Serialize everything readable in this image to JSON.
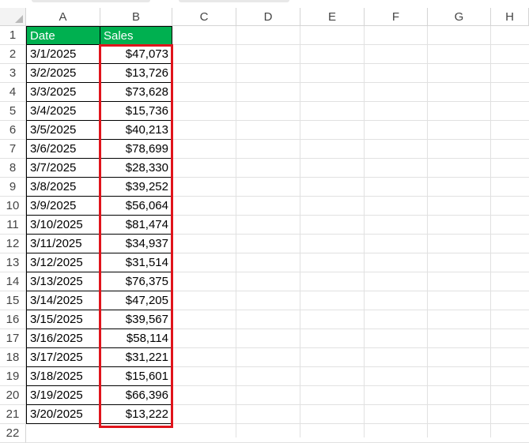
{
  "columns": [
    "A",
    "B",
    "C",
    "D",
    "E",
    "F",
    "G",
    "H"
  ],
  "rows": [
    "1",
    "2",
    "3",
    "4",
    "5",
    "6",
    "7",
    "8",
    "9",
    "10",
    "11",
    "12",
    "13",
    "14",
    "15",
    "16",
    "17",
    "18",
    "19",
    "20",
    "21",
    "22"
  ],
  "header": {
    "date": "Date",
    "sales": "Sales"
  },
  "data": [
    {
      "date": "3/1/2025",
      "sales": "$47,073"
    },
    {
      "date": "3/2/2025",
      "sales": "$13,726"
    },
    {
      "date": "3/3/2025",
      "sales": "$73,628"
    },
    {
      "date": "3/4/2025",
      "sales": "$15,736"
    },
    {
      "date": "3/5/2025",
      "sales": "$40,213"
    },
    {
      "date": "3/6/2025",
      "sales": "$78,699"
    },
    {
      "date": "3/7/2025",
      "sales": "$28,330"
    },
    {
      "date": "3/8/2025",
      "sales": "$39,252"
    },
    {
      "date": "3/9/2025",
      "sales": "$56,064"
    },
    {
      "date": "3/10/2025",
      "sales": "$81,474"
    },
    {
      "date": "3/11/2025",
      "sales": "$34,937"
    },
    {
      "date": "3/12/2025",
      "sales": "$31,514"
    },
    {
      "date": "3/13/2025",
      "sales": "$76,375"
    },
    {
      "date": "3/14/2025",
      "sales": "$47,205"
    },
    {
      "date": "3/15/2025",
      "sales": "$39,567"
    },
    {
      "date": "3/16/2025",
      "sales": "$58,114"
    },
    {
      "date": "3/17/2025",
      "sales": "$31,221"
    },
    {
      "date": "3/18/2025",
      "sales": "$15,601"
    },
    {
      "date": "3/19/2025",
      "sales": "$66,396"
    },
    {
      "date": "3/20/2025",
      "sales": "$13,222"
    }
  ],
  "colors": {
    "header_fill": "#00b050",
    "header_text": "#ffffff",
    "highlight": "#e0141c"
  }
}
